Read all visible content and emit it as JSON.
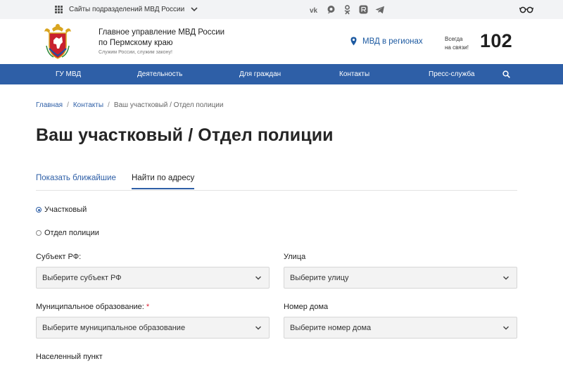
{
  "topbar": {
    "sites_label": "Сайты подразделений МВД России",
    "socials": [
      "vk-icon",
      "ok-chat-icon",
      "odnoklassniki-icon",
      "rutube-icon",
      "telegram-icon"
    ]
  },
  "header": {
    "org_line1": "Главное управление МВД России",
    "org_line2": "по Пермскому краю",
    "motto": "Служим России, служим закону!",
    "regions_label": "МВД в регионах",
    "always_line1": "Всегда",
    "always_line2": "на связи!",
    "hotline": "102"
  },
  "nav": {
    "items": [
      {
        "label": "ГУ МВД"
      },
      {
        "label": "Деятельность"
      },
      {
        "label": "Для граждан"
      },
      {
        "label": "Контакты"
      },
      {
        "label": "Пресс-служба"
      }
    ]
  },
  "breadcrumb": {
    "home": "Главная",
    "contacts": "Контакты",
    "sep": "/",
    "current": "Ваш участковый / Отдел полиции"
  },
  "page": {
    "title": "Ваш участковый / Отдел полиции"
  },
  "tabs": {
    "nearest": "Показать ближайшие",
    "by_address": "Найти по адресу"
  },
  "form": {
    "radios": [
      {
        "label": "Участковый",
        "checked": true
      },
      {
        "label": "Отдел полиции",
        "checked": false
      }
    ],
    "subject_label": "Субъект РФ:",
    "subject_value": "Выберите субъект РФ",
    "street_label": "Улица",
    "street_value": "Выберите улицу",
    "municipal_label": "Муниципальное образование:",
    "required_mark": "*",
    "municipal_value": "Выберите муниципальное образование",
    "house_label": "Номер дома",
    "house_value": "Выберите номер дома",
    "settlement_label": "Населенный пункт"
  },
  "colors": {
    "brand_blue": "#2e5fa7",
    "link_blue": "#1d5aa1",
    "topbar_bg": "#f2f3f5"
  }
}
